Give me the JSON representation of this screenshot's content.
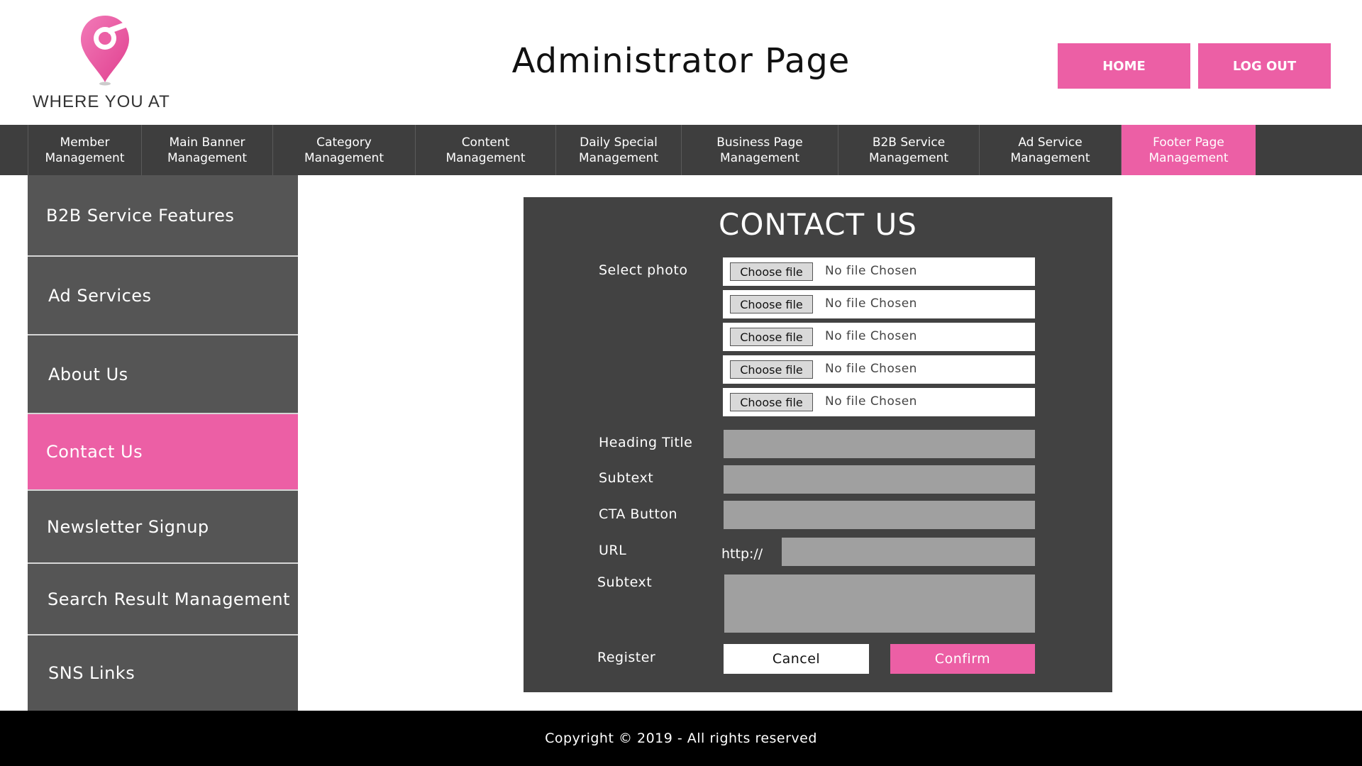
{
  "header": {
    "brand": "WHERE YOU AT",
    "title": "Administrator Page",
    "home_label": "HOME",
    "logout_label": "LOG OUT"
  },
  "topnav": {
    "items": [
      {
        "line1": "Member",
        "line2": "Management"
      },
      {
        "line1": "Main Banner",
        "line2": "Management"
      },
      {
        "line1": "Category",
        "line2": "Management"
      },
      {
        "line1": "Content",
        "line2": "Management"
      },
      {
        "line1": "Daily Special",
        "line2": "Management"
      },
      {
        "line1": "Business Page",
        "line2": "Management"
      },
      {
        "line1": "B2B Service",
        "line2": "Management"
      },
      {
        "line1": "Ad Service",
        "line2": "Management"
      },
      {
        "line1": "Footer Page",
        "line2": "Management"
      }
    ],
    "active": "Footer Page Management"
  },
  "sidebar": {
    "items": [
      {
        "label": "B2B Service Features"
      },
      {
        "label": "Ad Services"
      },
      {
        "label": "About Us"
      },
      {
        "label": "Contact Us"
      },
      {
        "label": "Newsletter Signup"
      },
      {
        "label": "Search Result Management"
      },
      {
        "label": "SNS Links"
      }
    ],
    "active": "Contact Us"
  },
  "form": {
    "title": "CONTACT US",
    "select_photo_label": "Select photo",
    "files": [
      {
        "button": "Choose file",
        "status": "No file Chosen"
      },
      {
        "button": "Choose file",
        "status": "No file Chosen"
      },
      {
        "button": "Choose file",
        "status": "No file Chosen"
      },
      {
        "button": "Choose file",
        "status": "No file Chosen"
      },
      {
        "button": "Choose file",
        "status": "No file Chosen"
      }
    ],
    "heading_title_label": "Heading Title",
    "heading_title_value": "",
    "subtext_label": "Subtext",
    "subtext_value": "",
    "cta_label": "CTA Button",
    "cta_value": "",
    "url_label": "URL",
    "url_prefix": "http://",
    "url_value": "",
    "subtext2_label": "Subtext",
    "subtext2_value": "",
    "register_label": "Register",
    "cancel_label": "Cancel",
    "confirm_label": "Confirm"
  },
  "footer": {
    "copyright": "Copyright © 2019 - All rights reserved"
  },
  "colors": {
    "accent": "#ec5fa5",
    "nav_bg": "#3e3e3e",
    "sidebar_bg": "#555555",
    "panel_bg": "#424242",
    "field_bg": "#a0a0a0",
    "footer_bg": "#000000"
  },
  "icons": {
    "logo": "map-pin-icon"
  }
}
